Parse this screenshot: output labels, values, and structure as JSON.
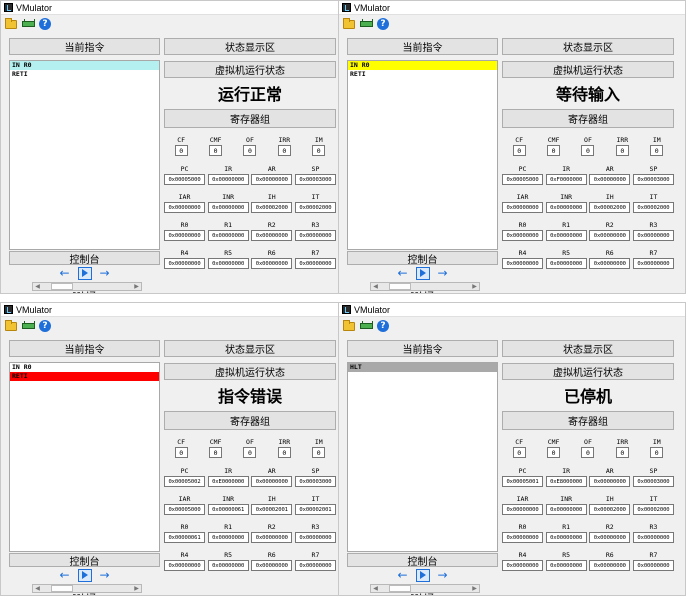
{
  "app_title": "VMulator",
  "labels": {
    "current_instruction": "当前指令",
    "status_area": "状态显示区",
    "vm_status": "虚拟机运行状态",
    "register_group": "寄存器组",
    "console": "控制台",
    "hz": "HZ"
  },
  "icons": {
    "open": "folder-open-icon",
    "chip": "memory-chip-icon",
    "help": "help-icon",
    "prev": "left-arrow-icon",
    "play": "play-icon",
    "next": "right-arrow-icon"
  },
  "highlight_colors": {
    "cyan": "#b4f0f0",
    "yellow": "#ffff00",
    "red": "#ff0000",
    "gray": "#a9a9a9"
  },
  "flag_names": [
    "CF",
    "CMF",
    "OF",
    "IRR",
    "IM"
  ],
  "register_rows": [
    [
      "PC",
      "IR",
      "AR",
      "SP"
    ],
    [
      "IAR",
      "INR",
      "IH",
      "IT"
    ],
    [
      "R0",
      "R1",
      "R2",
      "R3"
    ],
    [
      "R4",
      "R5",
      "R6",
      "R7"
    ]
  ],
  "windows": [
    {
      "status": "运行正常",
      "instructions": [
        "IN R0",
        "RETI"
      ],
      "highlight_index": 0,
      "highlight_color": "#b4f0f0",
      "flags": [
        "0",
        "0",
        "0",
        "0",
        "0"
      ],
      "registers": [
        [
          "0x00005000",
          "0x00000000",
          "0x00000000",
          "0x00003000"
        ],
        [
          "0x00000000",
          "0x00000000",
          "0x00002000",
          "0x00002000"
        ],
        [
          "0x00000000",
          "0x00000000",
          "0x00000000",
          "0x00000000"
        ],
        [
          "0x00000000",
          "0x00000000",
          "0x00000000",
          "0x00000000"
        ]
      ],
      "slider": 0.1
    },
    {
      "status": "等待输入",
      "instructions": [
        "IN R0",
        "RETI"
      ],
      "highlight_index": 0,
      "highlight_color": "#ffff00",
      "flags": [
        "0",
        "0",
        "0",
        "0",
        "0"
      ],
      "registers": [
        [
          "0x00005000",
          "0xF0000000",
          "0x00000000",
          "0x00003000"
        ],
        [
          "0x00000000",
          "0x00000000",
          "0x00002000",
          "0x00002000"
        ],
        [
          "0x00000000",
          "0x00000000",
          "0x00000000",
          "0x00000000"
        ],
        [
          "0x00000000",
          "0x00000000",
          "0x00000000",
          "0x00000000"
        ]
      ],
      "slider": 0.1
    },
    {
      "status": "指令错误",
      "instructions": [
        "IN R0",
        "RETI"
      ],
      "highlight_index": 1,
      "highlight_color": "#ff0000",
      "flags": [
        "0",
        "0",
        "0",
        "0",
        "0"
      ],
      "registers": [
        [
          "0x00005002",
          "0xE0000000",
          "0x00000000",
          "0x00003000"
        ],
        [
          "0x00005000",
          "0x00000061",
          "0x00002001",
          "0x00002001"
        ],
        [
          "0x00000061",
          "0x00000000",
          "0x00000000",
          "0x00000000"
        ],
        [
          "0x00000000",
          "0x00000000",
          "0x00000000",
          "0x00000000"
        ]
      ],
      "slider": 0.1
    },
    {
      "status": "已停机",
      "instructions": [
        "HLT"
      ],
      "highlight_index": 0,
      "highlight_color": "#a9a9a9",
      "flags": [
        "0",
        "0",
        "0",
        "0",
        "0"
      ],
      "registers": [
        [
          "0x00005001",
          "0xE8000000",
          "0x00000000",
          "0x00003000"
        ],
        [
          "0x00000000",
          "0x00000000",
          "0x00002000",
          "0x00002000"
        ],
        [
          "0x00000000",
          "0x00000000",
          "0x00000000",
          "0x00000000"
        ],
        [
          "0x00000000",
          "0x00000000",
          "0x00000000",
          "0x00000000"
        ]
      ],
      "slider": 0.1
    }
  ]
}
